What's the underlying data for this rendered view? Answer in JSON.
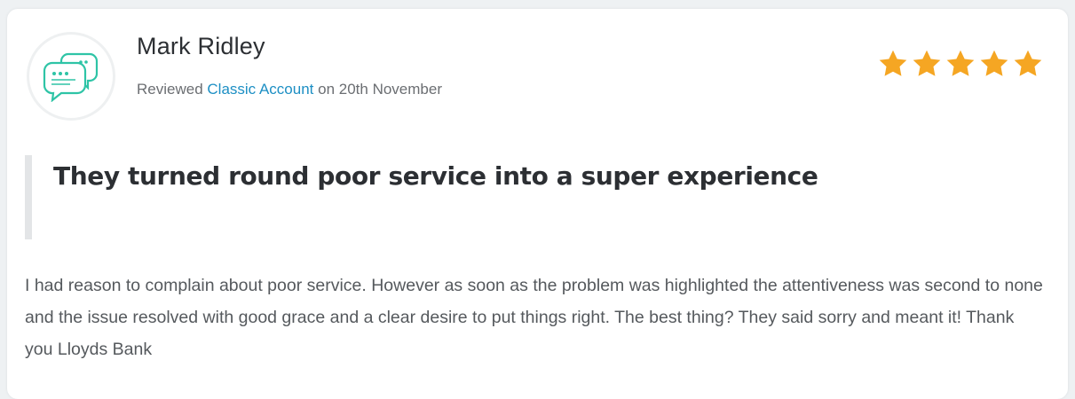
{
  "review": {
    "reviewer_name": "Mark Ridley",
    "reviewed_prefix": "Reviewed",
    "product": "Classic Account",
    "date_text": "on 20th November",
    "rating": 5,
    "rating_max": 5,
    "title": "They turned round poor service into a super experience",
    "body": "I had reason to complain about poor service. However as soon as the problem was highlighted the attentiveness was second to none and the issue resolved with good grace and a clear desire to put things right. The best thing? They said sorry and meant it! Thank you Lloyds Bank"
  },
  "icons": {
    "avatar": "chat-bubbles-icon",
    "star": "star-icon"
  },
  "colors": {
    "accent_link": "#1d8fc4",
    "star": "#f5a623",
    "avatar_icon": "#2ec4a6"
  }
}
